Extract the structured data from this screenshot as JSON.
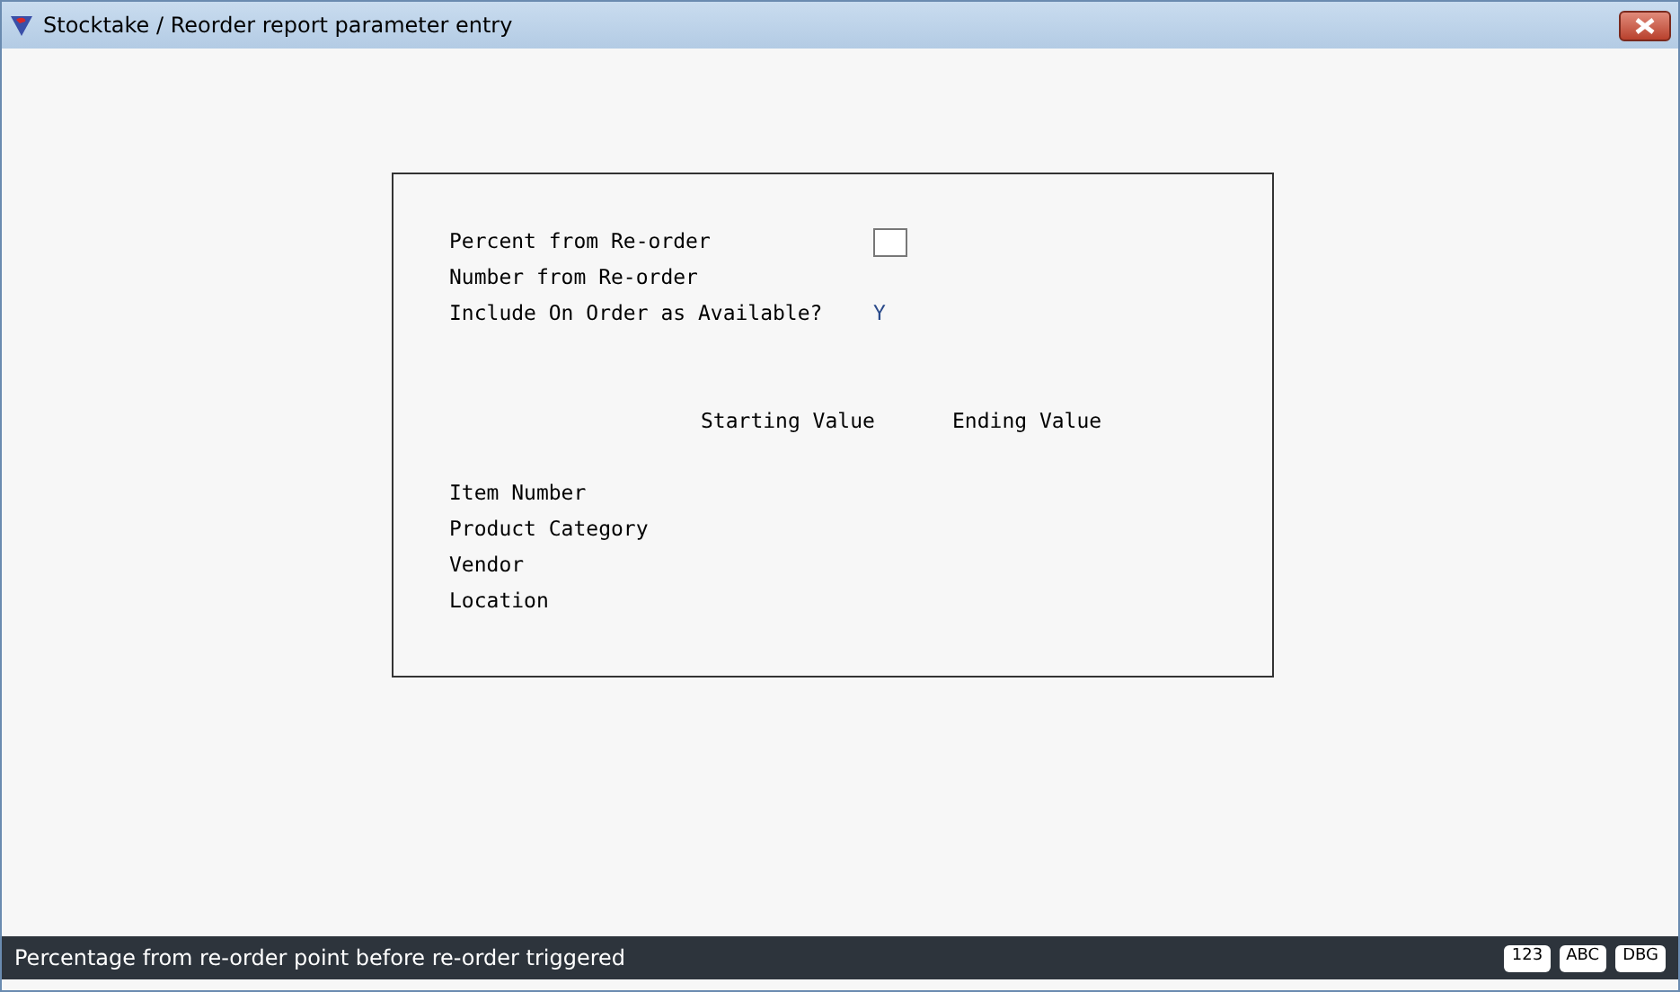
{
  "window": {
    "title": "Stocktake / Reorder report parameter entry"
  },
  "params": [
    {
      "label": "Percent from Re-order",
      "kind": "field"
    },
    {
      "label": "Number from Re-order",
      "kind": "blank"
    },
    {
      "label": "Include On Order as Available?",
      "kind": "value",
      "value": "Y"
    }
  ],
  "range": {
    "columns": [
      "Starting Value",
      "Ending Value"
    ],
    "rows": [
      {
        "label": "Item Number"
      },
      {
        "label": "Product Category"
      },
      {
        "label": "Vendor"
      },
      {
        "label": "Location"
      }
    ]
  },
  "status_bar": {
    "message": "Percentage from re-order point before re-order triggered",
    "badges": [
      "123",
      "ABC",
      "DBG"
    ]
  }
}
